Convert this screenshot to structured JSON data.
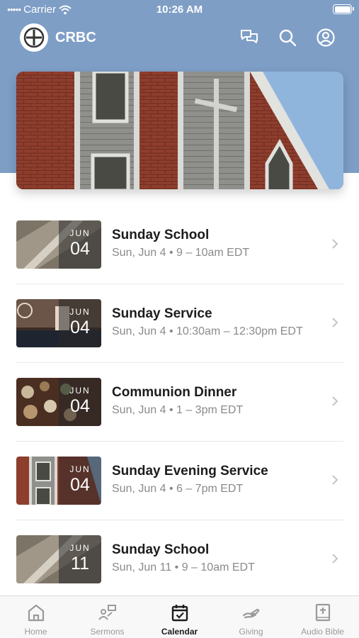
{
  "status_bar": {
    "carrier": "Carrier",
    "time": "10:26 AM"
  },
  "header": {
    "app_name": "CRBC"
  },
  "events": [
    {
      "title": "Sunday School",
      "subtitle": "Sun, Jun 4 • 9 – 10am EDT",
      "month": "JUN",
      "day": "04",
      "thumb": "siding"
    },
    {
      "title": "Sunday Service",
      "subtitle": "Sun, Jun 4 • 10:30am – 12:30pm EDT",
      "month": "JUN",
      "day": "04",
      "thumb": "stage"
    },
    {
      "title": "Communion Dinner",
      "subtitle": "Sun, Jun 4 • 1 – 3pm EDT",
      "month": "JUN",
      "day": "04",
      "thumb": "food"
    },
    {
      "title": "Sunday Evening Service",
      "subtitle": "Sun, Jun 4 • 6 – 7pm EDT",
      "month": "JUN",
      "day": "04",
      "thumb": "church"
    },
    {
      "title": "Sunday School",
      "subtitle": "Sun, Jun 11 • 9 – 10am EDT",
      "month": "JUN",
      "day": "11",
      "thumb": "siding"
    }
  ],
  "tabs": [
    {
      "label": "Home",
      "icon": "home-icon",
      "active": false
    },
    {
      "label": "Sermons",
      "icon": "sermons-icon",
      "active": false
    },
    {
      "label": "Calendar",
      "icon": "calendar-icon",
      "active": true
    },
    {
      "label": "Giving",
      "icon": "giving-icon",
      "active": false
    },
    {
      "label": "Audio Bible",
      "icon": "bible-icon",
      "active": false
    }
  ],
  "colors": {
    "header_bg": "#7e9ec6",
    "active_tab": "#1c1c1e",
    "inactive_tab": "#9a9a9a"
  }
}
